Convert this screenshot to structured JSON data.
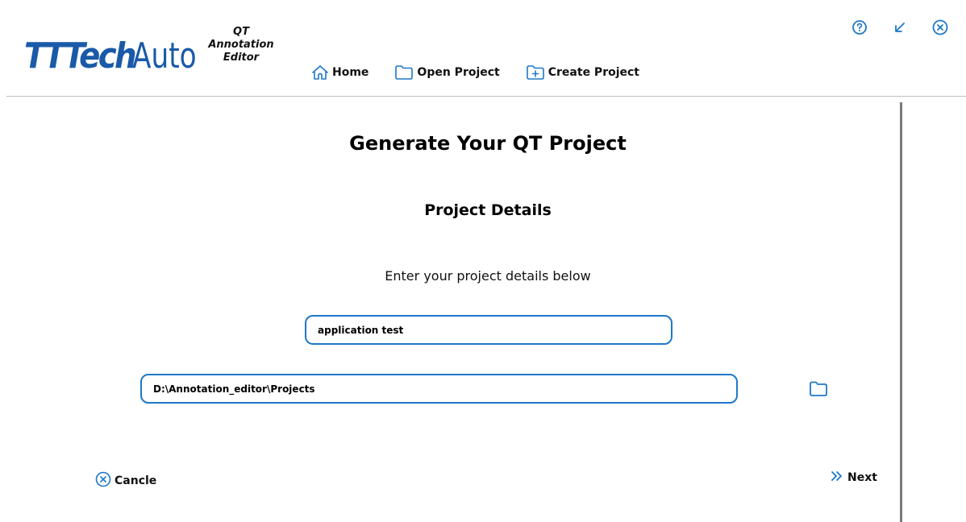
{
  "brand": {
    "logo_tt": "TT",
    "logo_tech": "Tech",
    "logo_auto": "Auto"
  },
  "app_name": {
    "line1": "QT",
    "line2": "Annotation",
    "line3": "Editor"
  },
  "nav": {
    "home": "Home",
    "open_project": "Open Project",
    "create_project": "Create Project"
  },
  "window_controls": [
    "help-icon",
    "minimize-icon",
    "close-icon"
  ],
  "page": {
    "title": "Generate Your QT Project",
    "section_title": "Project Details",
    "instruction": "Enter your project details below"
  },
  "form": {
    "project_name": "application test",
    "project_path": "D:\\Annotation_editor\\Projects"
  },
  "footer": {
    "cancel_label": "Cancle",
    "next_label": "Next"
  },
  "colors": {
    "accent": "#1e78c8",
    "brand": "#1a5aa8"
  }
}
